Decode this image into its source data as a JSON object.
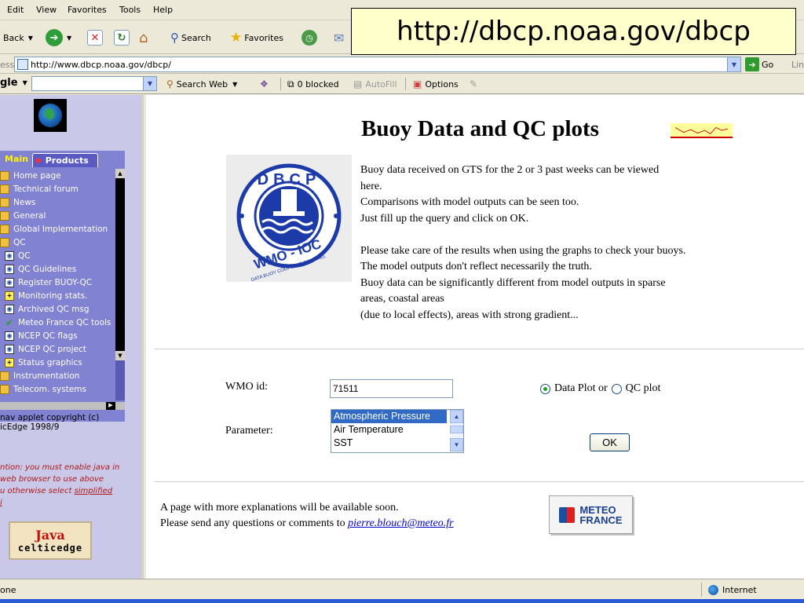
{
  "menu": [
    "Edit",
    "View",
    "Favorites",
    "Tools",
    "Help"
  ],
  "toolbar": {
    "back": "Back",
    "search": "Search",
    "favorites": "Favorites"
  },
  "url_banner": "http://dbcp.noaa.gov/dbcp",
  "address": {
    "label": "ess",
    "url": "http://www.dbcp.noaa.gov/dbcp/",
    "go": "Go",
    "links": "Lin"
  },
  "google_bar": {
    "brand": "gle",
    "search_web": "Search Web",
    "blocked": "0 blocked",
    "autofill": "AutoFill",
    "options": "Options"
  },
  "nav": {
    "tab_main": "Main",
    "tab_products": "Products",
    "items": [
      {
        "label": "Home page",
        "icon": "folder-icon",
        "level": "top"
      },
      {
        "label": "Technical forum",
        "icon": "folder-icon",
        "level": "top"
      },
      {
        "label": "News",
        "icon": "folder-icon",
        "level": "top"
      },
      {
        "label": "General",
        "icon": "folder-icon",
        "level": "top"
      },
      {
        "label": "Global Implementation",
        "icon": "folder-icon",
        "level": "top"
      },
      {
        "label": "QC",
        "icon": "folder-icon",
        "level": "top"
      },
      {
        "label": "QC",
        "icon": "doc-icon",
        "level": "sub"
      },
      {
        "label": "QC Guidelines",
        "icon": "doc-icon",
        "level": "sub"
      },
      {
        "label": "Register BUOY-QC",
        "icon": "doc-icon",
        "level": "sub"
      },
      {
        "label": "Monitoring stats.",
        "icon": "plus-icon",
        "level": "sub"
      },
      {
        "label": "Archived QC msg",
        "icon": "doc-icon",
        "level": "sub"
      },
      {
        "label": "Meteo France QC tools",
        "icon": "check-icon",
        "level": "sub"
      },
      {
        "label": "NCEP QC flags",
        "icon": "doc-icon",
        "level": "sub"
      },
      {
        "label": "NCEP QC project",
        "icon": "doc-icon",
        "level": "sub"
      },
      {
        "label": "Status graphics",
        "icon": "plus-icon",
        "level": "sub"
      },
      {
        "label": "Instrumentation",
        "icon": "folder-icon",
        "level": "top"
      },
      {
        "label": "Telecom. systems",
        "icon": "folder-icon",
        "level": "top"
      }
    ],
    "copyright_1": "nav applet copyright (c)",
    "copyright_2": "icEdge 1998/9",
    "attention_1": "ntion: you must enable java in",
    "attention_2": "web browser to use above",
    "attention_3": "u otherwise select ",
    "attention_link": "simplified",
    "attention_4": "i",
    "java_1": "Java",
    "java_2": "celticedge"
  },
  "page": {
    "title": "Buoy Data and QC plots",
    "intro": [
      "Buoy data received on GTS for the 2 or 3 past weeks can be viewed",
      "here.",
      "Comparisons with model outputs can be seen too.",
      "Just fill up the query and click on OK.",
      "",
      "Please take care of the results when using the graphs to check your buoys.",
      "The model outputs don't reflect necessarily the truth.",
      "Buoy data can be significantly different from model outputs in sparse",
      "areas, coastal areas",
      "(due to local effects), areas with strong gradient..."
    ],
    "logo_text_top": "DBCP",
    "logo_text_bottom": "WMO - IOC",
    "logo_ring": "DATA BUOY COOPERATION PANEL"
  },
  "form": {
    "wmo_label": "WMO id:",
    "wmo_value": "71511",
    "radio_data": "Data Plot or",
    "radio_qc": "QC plot",
    "parameter_label": "Parameter:",
    "parameters": [
      "Atmospheric Pressure",
      "Air Temperature",
      "SST"
    ],
    "ok": "OK"
  },
  "footer": {
    "line1": "A page with more explanations will be available soon.",
    "line2": "Please send any questions or comments to ",
    "email": "pierre.blouch@meteo.fr",
    "meteo_1": "METEO",
    "meteo_2": "FRANCE"
  },
  "status": {
    "left": "one",
    "zone": "Internet"
  }
}
